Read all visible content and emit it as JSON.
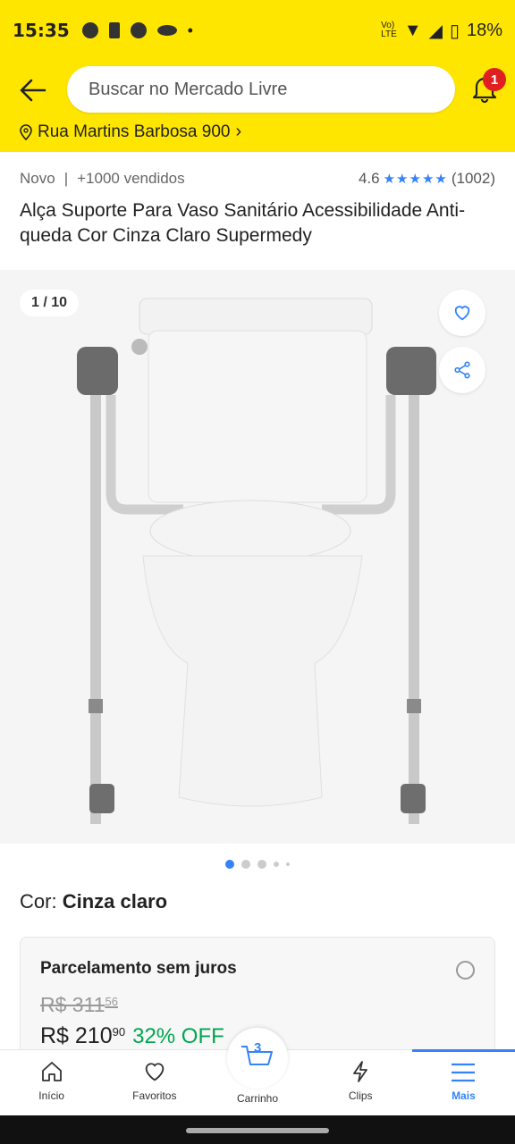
{
  "status": {
    "time": "15:35",
    "battery": "18%"
  },
  "header": {
    "search_placeholder": "Buscar no Mercado Livre",
    "notifications_count": "1",
    "address": "Rua Martins Barbosa 900"
  },
  "product": {
    "condition": "Novo",
    "sold": "+1000 vendidos",
    "rating": "4.6",
    "rating_count": "(1002)",
    "title": "Alça Suporte Para Vaso Sanitário Acessibilidade Anti-queda Cor Cinza Claro Supermedy",
    "image_counter": "1 / 10",
    "color_label": "Cor:",
    "color_value": "Cinza claro"
  },
  "payment": {
    "title": "Parcelamento sem juros",
    "old_price": "R$ 311",
    "old_cents": "56",
    "price": "R$ 210",
    "price_cents": "90",
    "discount": "32% OFF"
  },
  "nav": [
    {
      "label": "Início",
      "icon": "home-icon"
    },
    {
      "label": "Favoritos",
      "icon": "heart-icon"
    },
    {
      "label": "Carrinho",
      "icon": "cart-icon",
      "count": "3"
    },
    {
      "label": "Clips",
      "icon": "clips-icon"
    },
    {
      "label": "Mais",
      "icon": "menu-icon"
    }
  ],
  "colors": {
    "brand_yellow": "#ffe600",
    "accent_blue": "#3483fa",
    "discount_green": "#00a650",
    "badge_red": "#e02020"
  }
}
